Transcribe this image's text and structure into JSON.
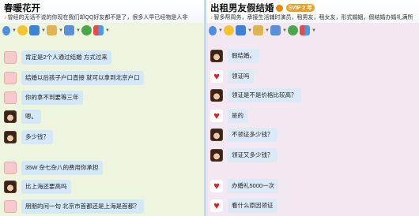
{
  "left": {
    "title": "春暖花开",
    "subtitle": "曾经的无话不说的你现在我们却QQ好友都不是了，很多人早已经物是人非",
    "messages": [
      {
        "text": "肯定是2个人通过结婚 方式过来"
      },
      {
        "text": "结婚以后孩子户口直接 就可以拿到北京户口"
      },
      {
        "text": "你的拿不到要等三年"
      },
      {
        "text": "嗯。"
      },
      {
        "text": "多少钱？"
      },
      {
        "text": "35W 杂七杂八的费用你承担"
      },
      {
        "text": "比上海还要高吗"
      },
      {
        "text": "朋朋的问一句 北京市首都还是上海是首都？"
      }
    ]
  },
  "right": {
    "title": "出租男友假结婚",
    "badge": "SVIP 2 年",
    "subtitle": "智多帮周务，承接生活辅时演员，租男友，租女友，形式婚姻，假结婚办婚礼满所",
    "messages": [
      {
        "text": "假结婚。"
      },
      {
        "text": "领证吗"
      },
      {
        "text": "领证是不是价格比较高？"
      },
      {
        "text": "是的"
      },
      {
        "text": "不领证多少钱？"
      },
      {
        "text": "领证又多少钱？"
      },
      {
        "text": "办婚礼5000一次"
      },
      {
        "text": "看什么原因领证"
      }
    ]
  }
}
